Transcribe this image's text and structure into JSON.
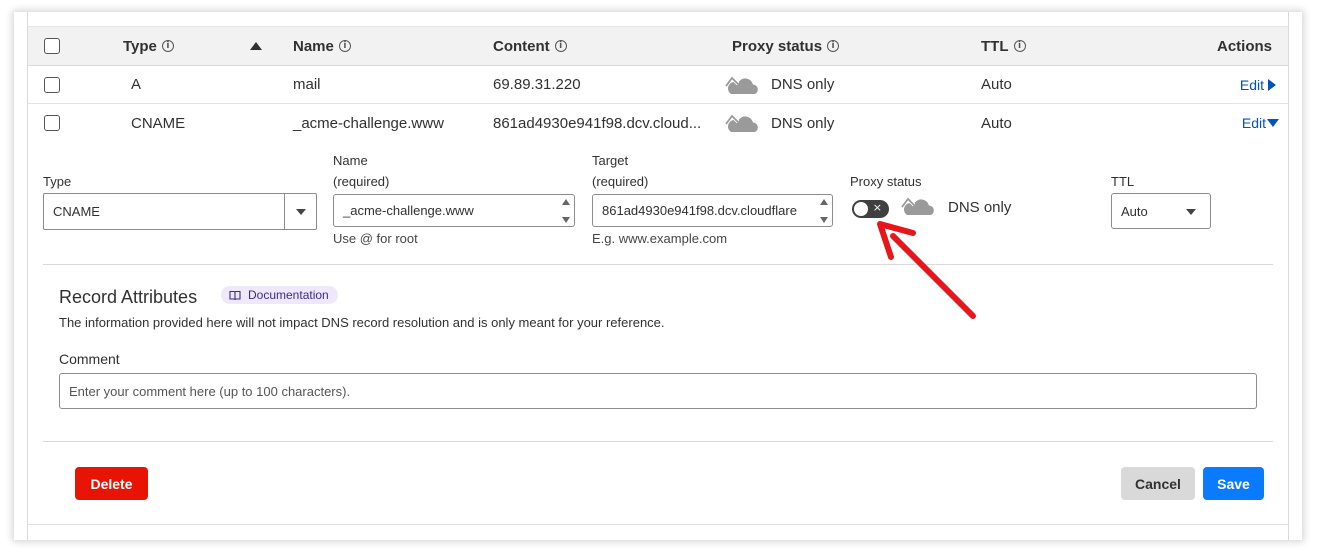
{
  "table": {
    "headers": {
      "type": "Type",
      "name": "Name",
      "content": "Content",
      "proxy_status": "Proxy status",
      "ttl": "TTL",
      "actions": "Actions"
    },
    "info_glyph": "i",
    "rows": [
      {
        "type": "A",
        "name": "mail",
        "content": "69.89.31.220",
        "proxy": "DNS only",
        "ttl": "Auto",
        "action": "Edit",
        "action_icon": "triangle-right-icon"
      },
      {
        "type": "CNAME",
        "name": "_acme-challenge.www",
        "content": "861ad4930e941f98.dcv.cloud...",
        "proxy": "DNS only",
        "ttl": "Auto",
        "action": "Edit",
        "action_icon": "triangle-down-icon"
      }
    ]
  },
  "editor": {
    "type_label": "Type",
    "type_value": "CNAME",
    "name_label": "Name",
    "name_required": "(required)",
    "name_value": "_acme-challenge.www",
    "name_hint": "Use @ for root",
    "target_label": "Target",
    "target_required": "(required)",
    "target_value": "861ad4930e941f98.dcv.cloudflare",
    "target_hint": "E.g. www.example.com",
    "proxy_label": "Proxy status",
    "proxy_value": "DNS only",
    "proxy_toggle_glyph": "×",
    "ttl_label": "TTL",
    "ttl_value": "Auto"
  },
  "attributes": {
    "title": "Record Attributes",
    "doc_link": "Documentation",
    "description": "The information provided here will not impact DNS record resolution and is only meant for your reference.",
    "comment_label": "Comment",
    "comment_placeholder": "Enter your comment here (up to 100 characters)."
  },
  "buttons": {
    "delete": "Delete",
    "cancel": "Cancel",
    "save": "Save"
  },
  "colors": {
    "delete_bg": "#e81403",
    "save_bg": "#0a7bff",
    "cancel_bg": "#d9d9d9",
    "link": "#0051c3",
    "annotation_arrow": "#e8151b",
    "cloud_gray": "#9a9a9a"
  }
}
